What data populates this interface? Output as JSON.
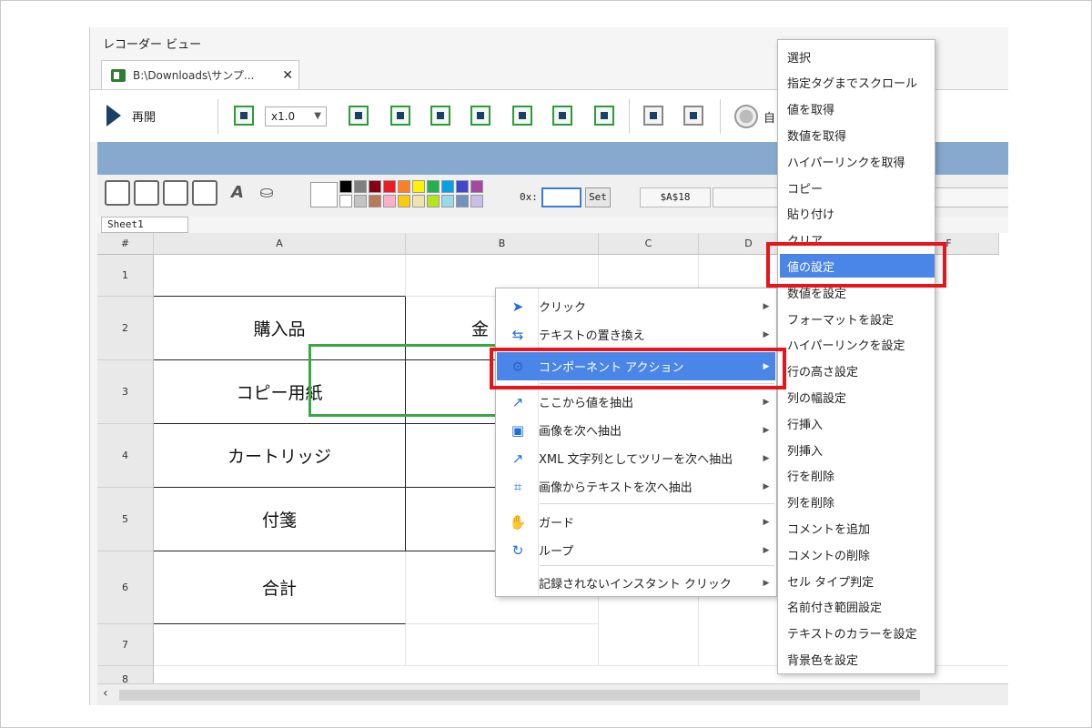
{
  "window": {
    "title": "レコーダー ビュー",
    "tab_label": "B:\\Downloads\\サンプ...",
    "tab_close": "✕"
  },
  "toolbar": {
    "resume_label": "再開",
    "speed_value": "x1.0",
    "record_label": "自"
  },
  "formatbar": {
    "offset_label": "0x:",
    "set_label": "Set",
    "cell_ref": "$A$18",
    "palette": [
      "#000000",
      "#7f7f7f",
      "#880015",
      "#ed1c24",
      "#ff7f27",
      "#fff200",
      "#22b14c",
      "#00a2e8",
      "#3f48cc",
      "#a349a4",
      "#ffffff",
      "#c3c3c3",
      "#b97a57",
      "#ffaec9",
      "#ffc90e",
      "#efe4b0",
      "#b5e61d",
      "#99d9ea",
      "#7092be",
      "#c8bfe7"
    ]
  },
  "sheet": {
    "tab": "Sheet1",
    "corner": "#",
    "columns": [
      "A",
      "B",
      "C",
      "D",
      "F"
    ],
    "rows": [
      "1",
      "2",
      "3",
      "4",
      "5",
      "6",
      "7",
      "8"
    ],
    "cells": {
      "a2": "購入品",
      "b2": "金",
      "a3": "コピー用紙",
      "a4": "カートリッジ",
      "a5": "付箋",
      "a6": "合計"
    }
  },
  "context_menu": {
    "items": [
      {
        "label": "クリック",
        "icon": "cursor-arrow-icon"
      },
      {
        "label": "テキストの置き換え",
        "icon": "text-replace-icon"
      },
      {
        "label": "コンポーネント アクション",
        "icon": "component-gear-icon"
      },
      {
        "label": "ここから値を抽出",
        "icon": "extract-arrow-icon"
      },
      {
        "label": "画像を次へ抽出",
        "icon": "image-icon"
      },
      {
        "label": "XML 文字列としてツリーを次へ抽出",
        "icon": "xml-arrow-icon"
      },
      {
        "label": "画像からテキストを次へ抽出",
        "icon": "ocr-icon"
      },
      {
        "label": "ガード",
        "icon": "hand-icon"
      },
      {
        "label": "ループ",
        "icon": "loop-icon"
      },
      {
        "label": "記録されないインスタント クリック",
        "icon": ""
      }
    ],
    "submenu_arrow": "▶"
  },
  "submenu": {
    "items": [
      "選択",
      "指定タグまでスクロール",
      "値を取得",
      "数値を取得",
      "ハイパーリンクを取得",
      "コピー",
      "貼り付け",
      "クリア",
      "値の設定",
      "数値を設定",
      "フォーマットを設定",
      "ハイパーリンクを設定",
      "行の高さ設定",
      "列の幅設定",
      "行挿入",
      "列挿入",
      "行を削除",
      "列を削除",
      "コメントを追加",
      "コメントの削除",
      "セル タイプ判定",
      "名前付き範囲設定",
      "テキストのカラーを設定",
      "背景色を設定"
    ]
  },
  "colors": {
    "accent_blue": "#4a86e8",
    "highlight_red": "#e8141c",
    "selection_green": "#39a844"
  }
}
